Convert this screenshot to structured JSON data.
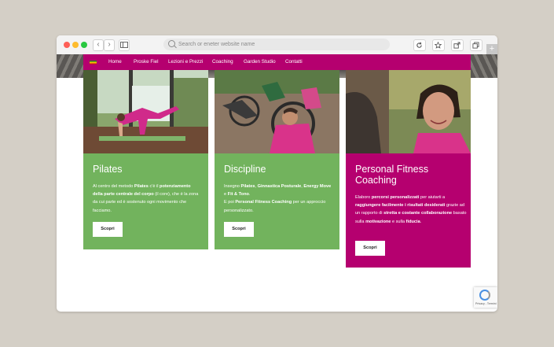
{
  "browser": {
    "address_placeholder": "Search or eneter website name",
    "back_glyph": "‹",
    "forward_glyph": "›",
    "sidebar_icon": "sidebar-icon",
    "toolbar_icons": [
      "reload-icon",
      "star-icon",
      "share-icon",
      "tabs-icon"
    ],
    "new_tab_glyph": "+"
  },
  "nav": {
    "flag": "italian-flag-icon",
    "items": [
      "Home",
      "Proske Fiel",
      "Lezioni e Prezzi",
      "Coaching",
      "Garden Studio",
      "Contatti"
    ]
  },
  "cards": [
    {
      "title": "Pilates",
      "text_html": "Al centro del metodo <b>Pilates</b> c'è il <b>potenziamento della parte centrale del corpo</b> (il core), che è la zona da cui parte ed è sostenuto ogni movimento che facciamo.",
      "button": "Scopri",
      "color": "#72b35d"
    },
    {
      "title": "Discipline",
      "text_html": "Insegno <b>Pilates</b>, <b>Ginnastica Posturale</b>, <b>Energy Move</b> e <b>Fit &amp; Tono</b>.<br>E poi <b>Personal Fitness Coaching</b> per un approccio personalizzato.",
      "button": "Scopri",
      "color": "#72b35d"
    },
    {
      "title": "Personal Fitness Coaching",
      "text_html": "Elaboro <b>percorsi personalizzati</b> per aiutarti a <b>raggiungere facilmente i risultati desiderati</b> grazie ad un rapporto di <b>stretta e costante collaborazione</b> basato sulla <b>motivazione</b> e sulla <b>fiducia</b>.",
      "button": "Scopri",
      "color": "#b5006f"
    }
  ],
  "recaptcha": {
    "links": "Privacy - Termini"
  },
  "colors": {
    "magenta": "#b5006f",
    "green": "#72b35d",
    "background": "#d4cfc6"
  }
}
